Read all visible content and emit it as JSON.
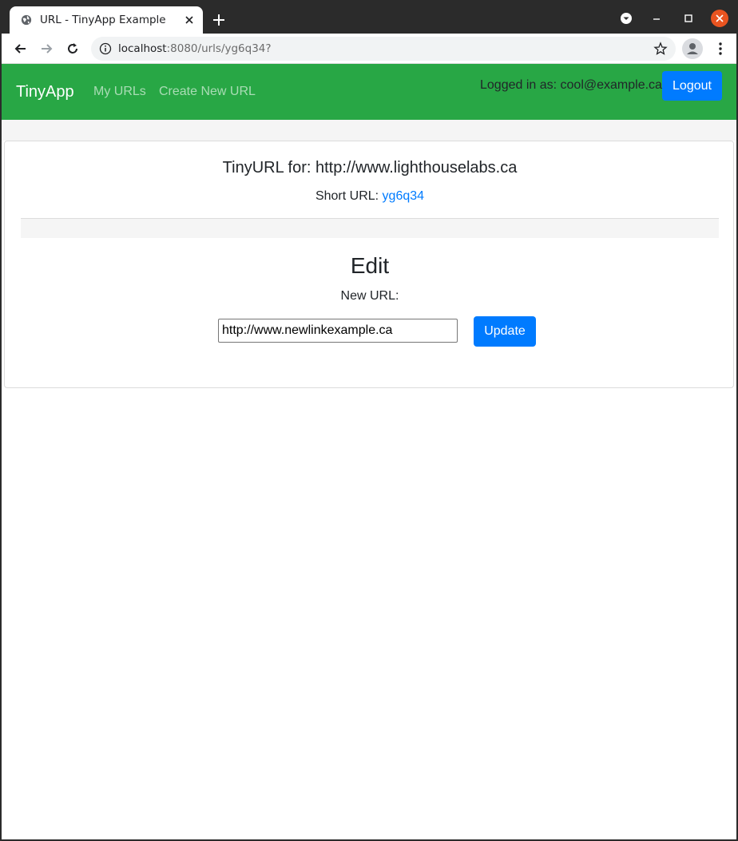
{
  "browser": {
    "tab_title": "URL - TinyApp Example",
    "url_host": "localhost",
    "url_path": ":8080/urls/yg6q34?"
  },
  "navbar": {
    "brand": "TinyApp",
    "links": [
      "My URLs",
      "Create New URL"
    ],
    "logged_in": "Logged in as: cool@example.ca",
    "logout_label": "Logout"
  },
  "card": {
    "title": "TinyURL for: http://www.lighthouselabs.ca",
    "short_url_label": "Short URL:",
    "short_url_value": "yg6q34",
    "edit_heading": "Edit",
    "new_url_label": "New URL:",
    "new_url_value": "http://www.newlinkexample.ca",
    "update_label": "Update"
  },
  "colors": {
    "navbar": "#28a745",
    "primary": "#007bff"
  }
}
